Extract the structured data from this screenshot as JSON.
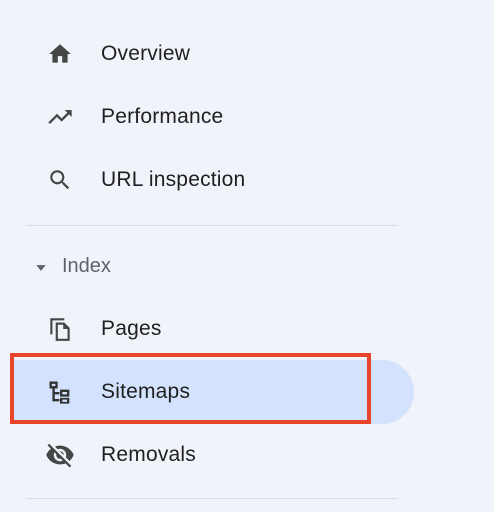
{
  "nav": {
    "items": [
      {
        "label": "Overview",
        "icon": "home-icon"
      },
      {
        "label": "Performance",
        "icon": "trending-up-icon"
      },
      {
        "label": "URL inspection",
        "icon": "search-icon"
      }
    ],
    "index_section": {
      "label": "Index",
      "icon": "caret-down-icon",
      "items": [
        {
          "label": "Pages",
          "icon": "pages-icon"
        },
        {
          "label": "Sitemaps",
          "icon": "sitemap-icon",
          "selected": true
        },
        {
          "label": "Removals",
          "icon": "visibility-off-icon"
        }
      ]
    }
  },
  "colors": {
    "background": "#f1f3fb",
    "selected_background": "#d3e3fd",
    "highlight_border": "#e8442a",
    "icon": "#444746",
    "text": "#1f1f1f",
    "section_text": "#5f6368"
  }
}
